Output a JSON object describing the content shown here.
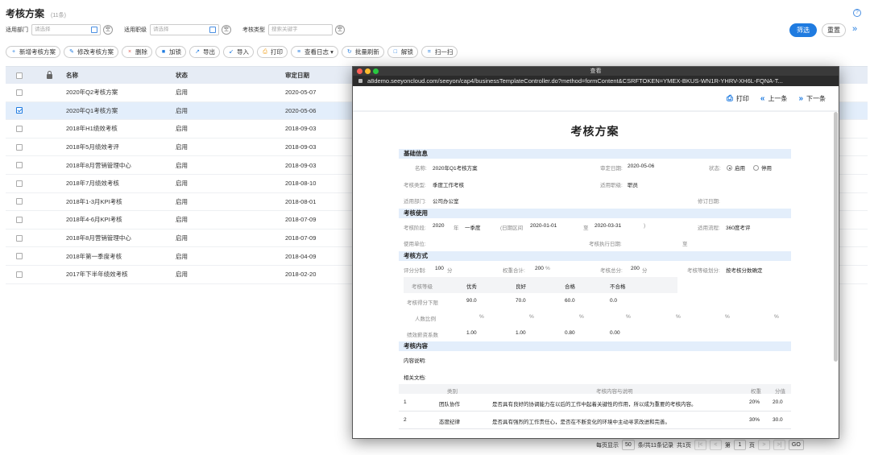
{
  "page": {
    "title": "考核方案",
    "count": "(11条)",
    "help_icon": "question-circle-icon"
  },
  "filters": {
    "dept_label": "适用部门",
    "dept_placeholder": "请选择",
    "position_label": "适用职级",
    "position_placeholder": "请选择",
    "type_label": "考核类型",
    "type_placeholder": "搜索关键字",
    "empty_label": "空",
    "filter_button": "筛选",
    "reset_button": "重置",
    "collapse_icon": "double-chevron-right-icon"
  },
  "toolbar": [
    {
      "label": "新增考核方案",
      "icon": "+",
      "icon_color": "#1f7be0"
    },
    {
      "label": "修改考核方案",
      "icon": "✎",
      "icon_color": "#1f7be0"
    },
    {
      "label": "删除",
      "icon": "×",
      "icon_color": "#e05a4f"
    },
    {
      "label": "加锁",
      "icon": "■",
      "icon_color": "#1f7be0"
    },
    {
      "label": "导出",
      "icon": "↗",
      "icon_color": "#1f7be0"
    },
    {
      "label": "导入",
      "icon": "↙",
      "icon_color": "#1f7be0"
    },
    {
      "label": "打印",
      "icon": "⎙",
      "icon_color": "#f0a020"
    },
    {
      "label": "查看日志 ▾",
      "icon": "≡",
      "icon_color": "#1f7be0"
    },
    {
      "label": "批量刷新",
      "icon": "↻",
      "icon_color": "#1f7be0"
    },
    {
      "label": "解锁",
      "icon": "□",
      "icon_color": "#1f7be0"
    },
    {
      "label": "扫一扫",
      "icon": "⌗",
      "icon_color": "#1f7be0"
    }
  ],
  "grid": {
    "headers": {
      "name": "名称",
      "status": "状态",
      "date": "审定日期"
    },
    "rows": [
      {
        "name": "2020年Q2考核方案",
        "status": "启用",
        "date": "2020-05-07",
        "checked": false
      },
      {
        "name": "2020年Q1考核方案",
        "status": "启用",
        "date": "2020-05-06",
        "checked": true
      },
      {
        "name": "2018年H1绩效考核",
        "status": "启用",
        "date": "2018-09-03",
        "checked": false
      },
      {
        "name": "2018年5月绩效考评",
        "status": "启用",
        "date": "2018-09-03",
        "checked": false
      },
      {
        "name": "2018年8月营销管理中心",
        "status": "启用",
        "date": "2018-09-03",
        "checked": false
      },
      {
        "name": "2018年7月绩效考核",
        "status": "启用",
        "date": "2018-08-10",
        "checked": false
      },
      {
        "name": "2018年1-3月KPI考核",
        "status": "启用",
        "date": "2018-08-01",
        "checked": false
      },
      {
        "name": "2018年4-6月KPI考核",
        "status": "启用",
        "date": "2018-07-09",
        "checked": false
      },
      {
        "name": "2018年8月营销管理中心",
        "status": "启用",
        "date": "2018-07-09",
        "checked": false
      },
      {
        "name": "2018年第一季度考核",
        "status": "启用",
        "date": "2018-04-09",
        "checked": false
      },
      {
        "name": "2017年下半年绩效考核",
        "status": "启用",
        "date": "2018-02-20",
        "checked": false
      }
    ]
  },
  "pager": {
    "per_page_label": "每页显示",
    "per_page": "50",
    "total": "条/共11条记录",
    "pages": "共1页",
    "page_prefix": "第",
    "page": "1",
    "page_suffix": "页",
    "go": "GO"
  },
  "popup": {
    "window_title": "查看",
    "url": "a8demo.seeyoncloud.com/seeyon/cap4/businessTemplateController.do?method=formContent&CSRFTOKEN=YMEX-BKUS-WN1R-YHRV-XH6L-FQNA-T...",
    "print": "打印",
    "prev": "上一条",
    "next": "下一条",
    "form_title": "考核方案",
    "sections": {
      "basic": "基础信息",
      "usage": "考核使用",
      "method": "考核方式",
      "content": "考核内容"
    },
    "basic": {
      "name_label": "名称:",
      "name_value": "2020年Q1考核方案",
      "date_label": "审定日期:",
      "date_value": "2020-05-06",
      "status_label": "状态:",
      "status_on": "启用",
      "status_off": "停用",
      "type_label": "考核类型:",
      "type_value": "季度工作考核",
      "position_label": "适用职级:",
      "position_value": "职员",
      "dept_label": "适用部门:",
      "dept_value": "公司办公室",
      "revise_label": "修订日期:"
    },
    "usage": {
      "period_label": "考核阶段:",
      "year": "2020",
      "year_unit": "年",
      "quarter": "一季度",
      "range_label": "(日期区间",
      "range_start": "2020-01-01",
      "range_to": "至",
      "range_end": "2020-03-31",
      "range_close": ")",
      "flow_label": "适用流程:",
      "flow_value": "360度考评",
      "unit_label": "使用单位:",
      "exec_label": "考核执行日期:",
      "exec_to": "至"
    },
    "method": {
      "score_label": "评分分制:",
      "score_value": "100",
      "score_unit": "分",
      "weight_label": "权重合计:",
      "weight_value": "200",
      "weight_unit": "%",
      "total_label": "考核总分:",
      "total_value": "200",
      "total_unit": "分",
      "grade_label": "考核等级划分:",
      "grade_value": "按考核分数确定",
      "grade_table": {
        "row_labels": [
          "考核等级",
          "考核得分下限",
          "人数比例",
          "绩效薪资系数"
        ],
        "grades": [
          "优秀",
          "良好",
          "合格",
          "不合格"
        ],
        "min_scores": [
          "90.0",
          "70.0",
          "60.0",
          "0.0"
        ],
        "ratio_unit": "%",
        "coefficients": [
          "1.00",
          "1.00",
          "0.80",
          "0.00"
        ]
      }
    },
    "content": {
      "desc_label": "内容说明:",
      "doc_label": "相关文档:",
      "headers": {
        "category": "类别",
        "desc": "考核内容与说明",
        "weight": "权重",
        "score": "分值"
      },
      "rows": [
        {
          "no": "1",
          "category": "团队协作",
          "desc": "是否具有良好的协调能力在以后的工作中起着关键性的作用，所以成为重要的考核内容。",
          "weight": "20%",
          "score": "20.0"
        },
        {
          "no": "2",
          "category": "态度纪律",
          "desc": "是否具有强烈的工作责任心，是否在不断变化的环境中主动寻求改进和完善。",
          "weight": "30%",
          "score": "30.0"
        }
      ]
    }
  }
}
